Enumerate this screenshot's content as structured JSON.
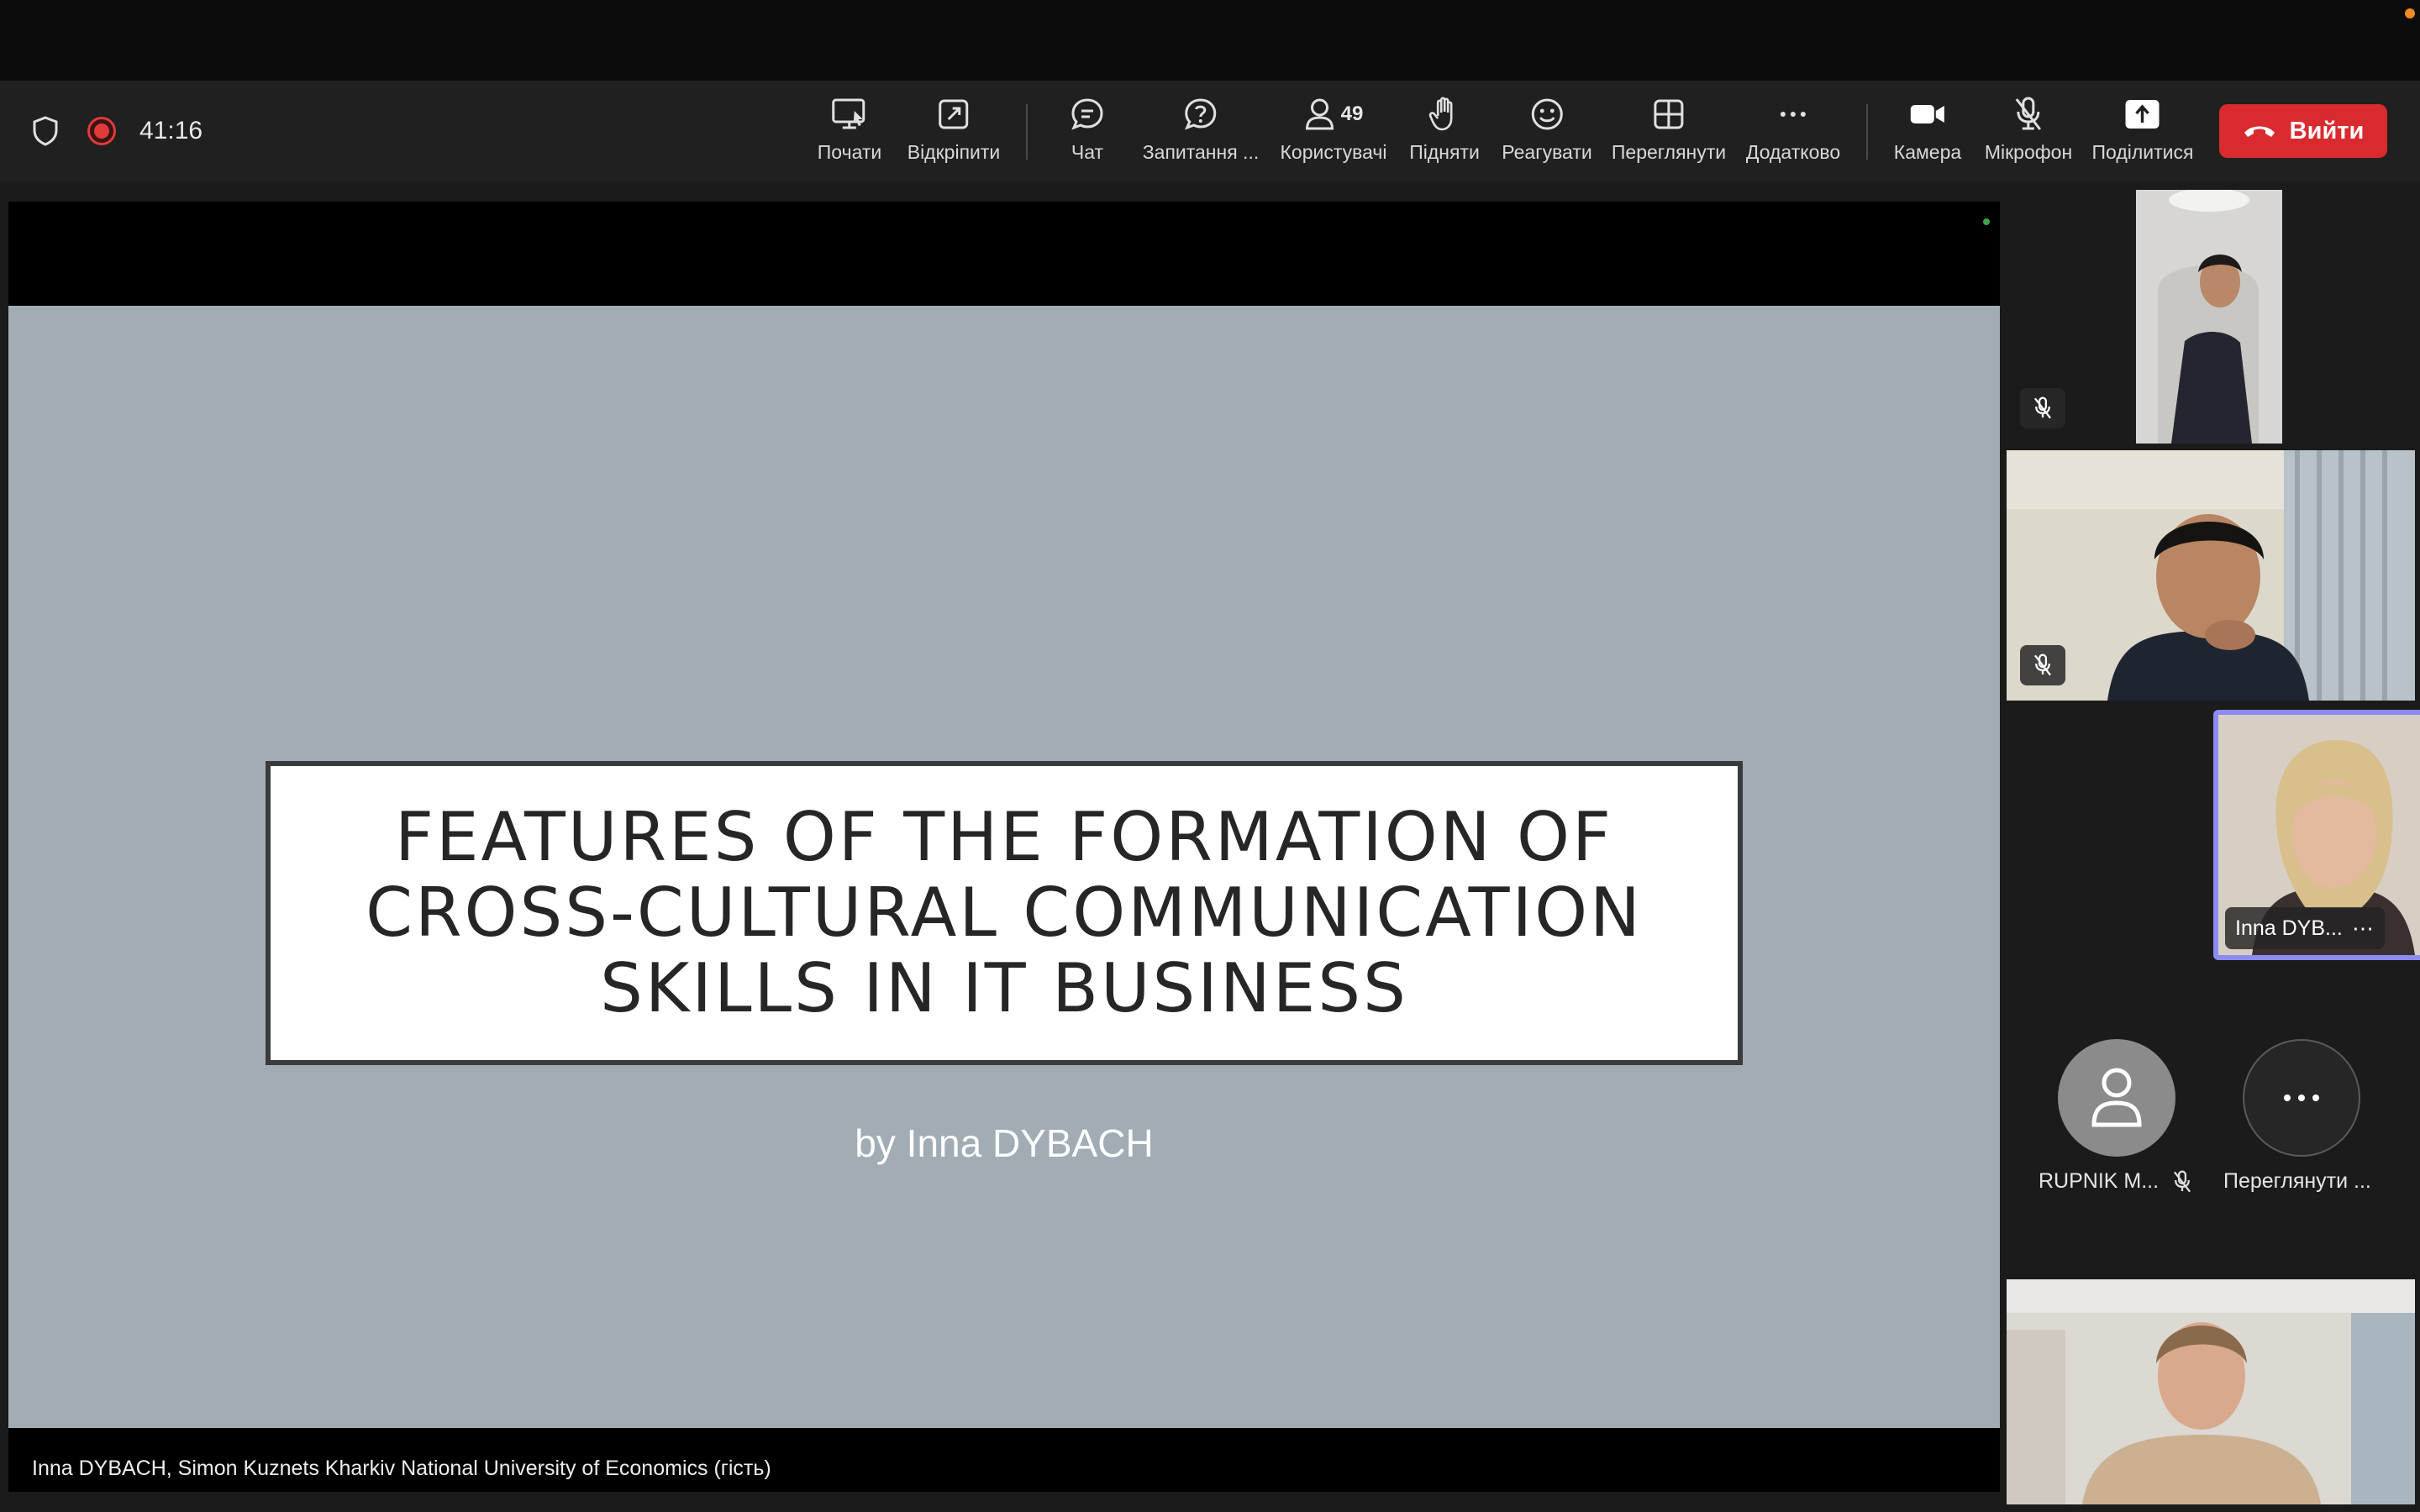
{
  "toolbar": {
    "timer": "41:16",
    "buttons": [
      {
        "label": "Почати",
        "icon": "share-screen-icon"
      },
      {
        "label": "Відкріпити",
        "icon": "unpin-icon"
      },
      {
        "label": "Чат",
        "icon": "chat-icon"
      },
      {
        "label": "Запитання ...",
        "icon": "question-icon"
      },
      {
        "label": "Користувачі",
        "icon": "users-icon",
        "count": "49"
      },
      {
        "label": "Підняти",
        "icon": "raise-hand-icon"
      },
      {
        "label": "Реагувати",
        "icon": "smile-icon"
      },
      {
        "label": "Переглянути",
        "icon": "grid-view-icon"
      },
      {
        "label": "Додатково",
        "icon": "more-icon"
      },
      {
        "label": "Камера",
        "icon": "camera-icon"
      },
      {
        "label": "Мікрофон",
        "icon": "mic-off-icon"
      },
      {
        "label": "Поділитися",
        "icon": "share-up-icon"
      }
    ],
    "leave_label": "Вийти",
    "leave_color": "#d92b2f"
  },
  "slide": {
    "title_lines": [
      "FEATURES OF THE FORMATION OF",
      "CROSS-CULTURAL COMMUNICATION",
      "SKILLS IN IT BUSINESS"
    ],
    "byline": "by Inna DYBACH",
    "background": "#a1acb5"
  },
  "presenter_caption": "Inna DYBACH, Simon Kuznets Kharkiv National University of Economics (гість)",
  "participants": {
    "active_speaker_name": "Inna DYB...",
    "active_speaker_more": "⋯",
    "rupnik_name": "RUPNIK M...",
    "view_more_label": "Переглянути ...",
    "active_border_color": "#8b8bf2"
  }
}
